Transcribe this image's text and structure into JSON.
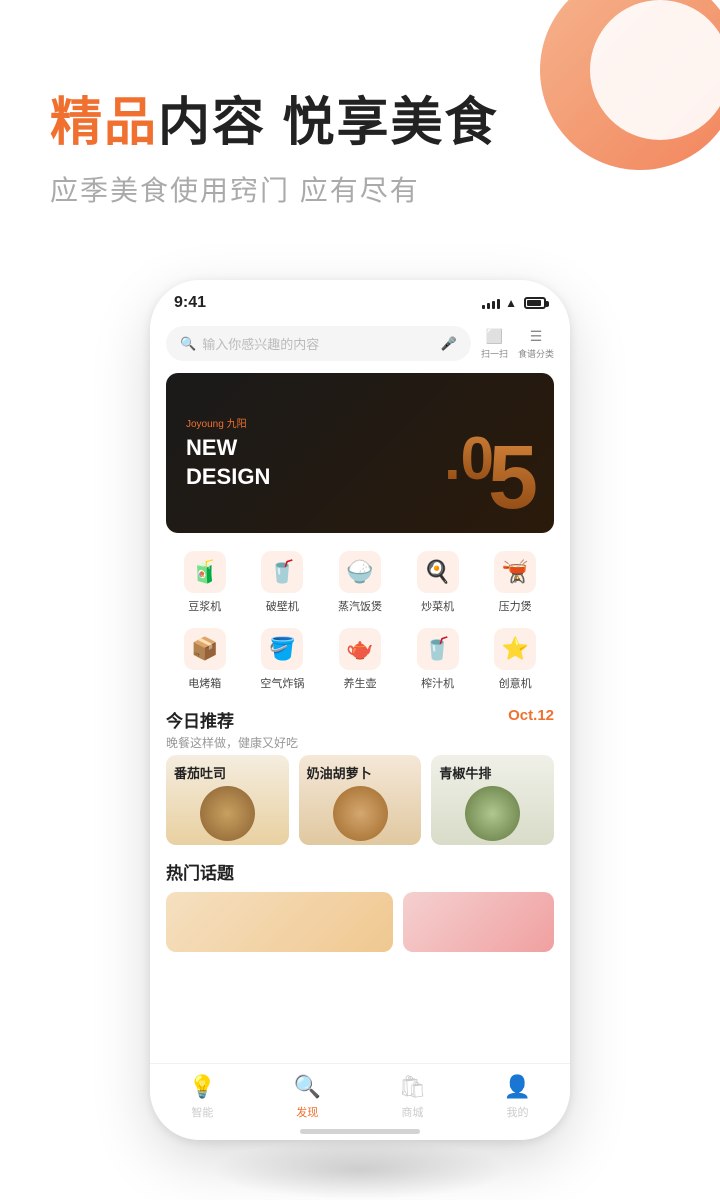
{
  "hero": {
    "title_highlight": "精品",
    "title_rest": "内容 悦享美食",
    "subtitle": "应季美食使用窍门 应有尽有"
  },
  "phone": {
    "status": {
      "time": "9:41"
    },
    "search": {
      "placeholder": "输入你感兴趣的内容",
      "scan_label": "扫一扫",
      "category_label": "食谱分类"
    },
    "banner": {
      "brand": "Joyoung 九阳",
      "line1": "NEW",
      "line2": "DESIGN",
      "version": "5.0"
    },
    "categories_row1": [
      {
        "icon": "🧃",
        "label": "豆浆机"
      },
      {
        "icon": "🥤",
        "label": "破壁机"
      },
      {
        "icon": "🍚",
        "label": "蒸汽饭煲"
      },
      {
        "icon": "🍳",
        "label": "炒菜机"
      },
      {
        "icon": "🫕",
        "label": "压力煲"
      }
    ],
    "categories_row2": [
      {
        "icon": "📦",
        "label": "电烤箱"
      },
      {
        "icon": "🪣",
        "label": "空气炸锅"
      },
      {
        "icon": "🫖",
        "label": "养生壶"
      },
      {
        "icon": "🥤",
        "label": "榨汁机"
      },
      {
        "icon": "⭐",
        "label": "创意机"
      }
    ],
    "today_rec": {
      "title": "今日推荐",
      "subtitle": "晚餐这样做，健康又好吃",
      "date": "Oct.12",
      "cards": [
        {
          "name": "番茄吐司",
          "color": "#e8d5b0"
        },
        {
          "name": "奶油胡萝卜",
          "color": "#d4b896"
        },
        {
          "name": "青椒牛排",
          "color": "#c8d4b0"
        }
      ]
    },
    "hot_topics": {
      "title": "热门话题"
    },
    "bottom_nav": [
      {
        "label": "智能",
        "icon": "💡",
        "active": false
      },
      {
        "label": "发现",
        "icon": "🔍",
        "active": true
      },
      {
        "label": "商城",
        "icon": "🛍",
        "active": false
      },
      {
        "label": "我的",
        "icon": "👤",
        "active": false
      }
    ]
  }
}
